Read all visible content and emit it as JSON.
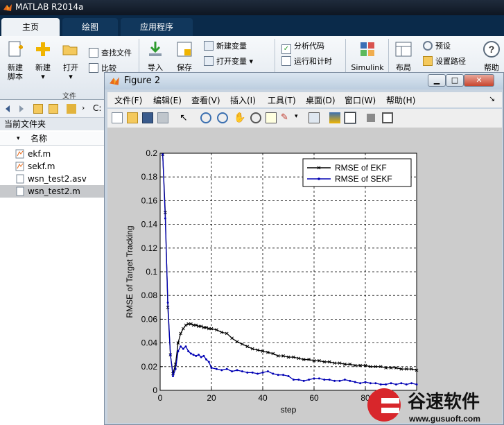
{
  "app": {
    "title": "MATLAB R2014a"
  },
  "tabs": [
    {
      "label": "主页",
      "active": true
    },
    {
      "label": "绘图",
      "active": false
    },
    {
      "label": "应用程序",
      "active": false
    }
  ],
  "ribbon": {
    "new_script": "新建\n脚本",
    "new_script_l1": "新建",
    "new_script_l2": "脚本",
    "new": "新建",
    "open": "打开",
    "find_files": "查找文件",
    "compare": "比较",
    "file_group": "文件",
    "import": "导入",
    "save": "保存",
    "new_variable": "新建变量",
    "open_variable": "打开变量",
    "analyze_code": "分析代码",
    "run_and_time": "运行和计时",
    "simulink": "Simulink",
    "layout": "布局",
    "preferences": "预设",
    "set_path": "设置路径",
    "help": "帮助"
  },
  "nav": {
    "path": "C:"
  },
  "current_folder": {
    "title": "当前文件夹",
    "column_name": "名称",
    "files": [
      {
        "name": "ekf.m",
        "selected": false
      },
      {
        "name": "sekf.m",
        "selected": false
      },
      {
        "name": "wsn_test2.asv",
        "selected": false
      },
      {
        "name": "wsn_test2.m",
        "selected": true
      }
    ]
  },
  "figure": {
    "title": "Figure 2",
    "menu": [
      "文件(F)",
      "编辑(E)",
      "查看(V)",
      "插入(I)",
      "工具(T)",
      "桌面(D)",
      "窗口(W)",
      "帮助(H)"
    ]
  },
  "chart_data": {
    "type": "line",
    "title": "",
    "xlabel": "step",
    "ylabel": "RMSE of Target Tracking",
    "xlim": [
      0,
      100
    ],
    "ylim": [
      0,
      0.2
    ],
    "xticks": [
      0,
      20,
      40,
      60,
      80
    ],
    "yticks": [
      0,
      0.02,
      0.04,
      0.06,
      0.08,
      0.1,
      0.12,
      0.14,
      0.16,
      0.18,
      0.2
    ],
    "grid": true,
    "legend_position": "top-right",
    "series": [
      {
        "name": "RMSE of EKF",
        "color": "#000000",
        "marker": "x",
        "x": [
          1,
          2,
          3,
          4,
          5,
          6,
          7,
          8,
          9,
          10,
          11,
          12,
          13,
          14,
          15,
          16,
          17,
          18,
          19,
          20,
          22,
          24,
          26,
          28,
          30,
          32,
          34,
          36,
          38,
          40,
          42,
          44,
          46,
          48,
          50,
          52,
          54,
          56,
          58,
          60,
          62,
          64,
          66,
          68,
          70,
          72,
          74,
          76,
          78,
          80,
          82,
          84,
          86,
          88,
          90,
          92,
          94,
          96,
          98,
          100
        ],
        "y": [
          0.199,
          0.15,
          0.07,
          0.03,
          0.014,
          0.022,
          0.04,
          0.048,
          0.052,
          0.055,
          0.056,
          0.056,
          0.055,
          0.055,
          0.054,
          0.054,
          0.053,
          0.053,
          0.052,
          0.052,
          0.051,
          0.049,
          0.048,
          0.044,
          0.041,
          0.039,
          0.037,
          0.035,
          0.034,
          0.033,
          0.032,
          0.031,
          0.029,
          0.029,
          0.028,
          0.028,
          0.027,
          0.026,
          0.026,
          0.025,
          0.025,
          0.024,
          0.024,
          0.023,
          0.023,
          0.022,
          0.022,
          0.021,
          0.021,
          0.021,
          0.02,
          0.02,
          0.02,
          0.019,
          0.019,
          0.019,
          0.018,
          0.018,
          0.018,
          0.017
        ]
      },
      {
        "name": "RMSE of SEKF",
        "color": "#0000b4",
        "marker": "dot",
        "x": [
          1,
          2,
          3,
          4,
          5,
          6,
          7,
          8,
          9,
          10,
          11,
          12,
          13,
          14,
          15,
          16,
          17,
          18,
          19,
          20,
          22,
          24,
          26,
          28,
          30,
          32,
          34,
          36,
          38,
          40,
          42,
          44,
          46,
          48,
          50,
          52,
          54,
          56,
          58,
          60,
          62,
          64,
          66,
          68,
          70,
          72,
          74,
          76,
          78,
          80,
          82,
          84,
          86,
          88,
          90,
          92,
          94,
          96,
          98,
          100
        ],
        "y": [
          0.199,
          0.145,
          0.074,
          0.03,
          0.012,
          0.018,
          0.033,
          0.037,
          0.035,
          0.037,
          0.033,
          0.031,
          0.03,
          0.029,
          0.03,
          0.028,
          0.029,
          0.026,
          0.024,
          0.019,
          0.018,
          0.017,
          0.018,
          0.016,
          0.017,
          0.016,
          0.015,
          0.015,
          0.014,
          0.015,
          0.016,
          0.014,
          0.013,
          0.013,
          0.012,
          0.009,
          0.009,
          0.008,
          0.009,
          0.01,
          0.01,
          0.009,
          0.009,
          0.008,
          0.008,
          0.009,
          0.008,
          0.007,
          0.006,
          0.007,
          0.006,
          0.006,
          0.005,
          0.005,
          0.006,
          0.005,
          0.006,
          0.005,
          0.006,
          0.005
        ]
      }
    ]
  }
}
